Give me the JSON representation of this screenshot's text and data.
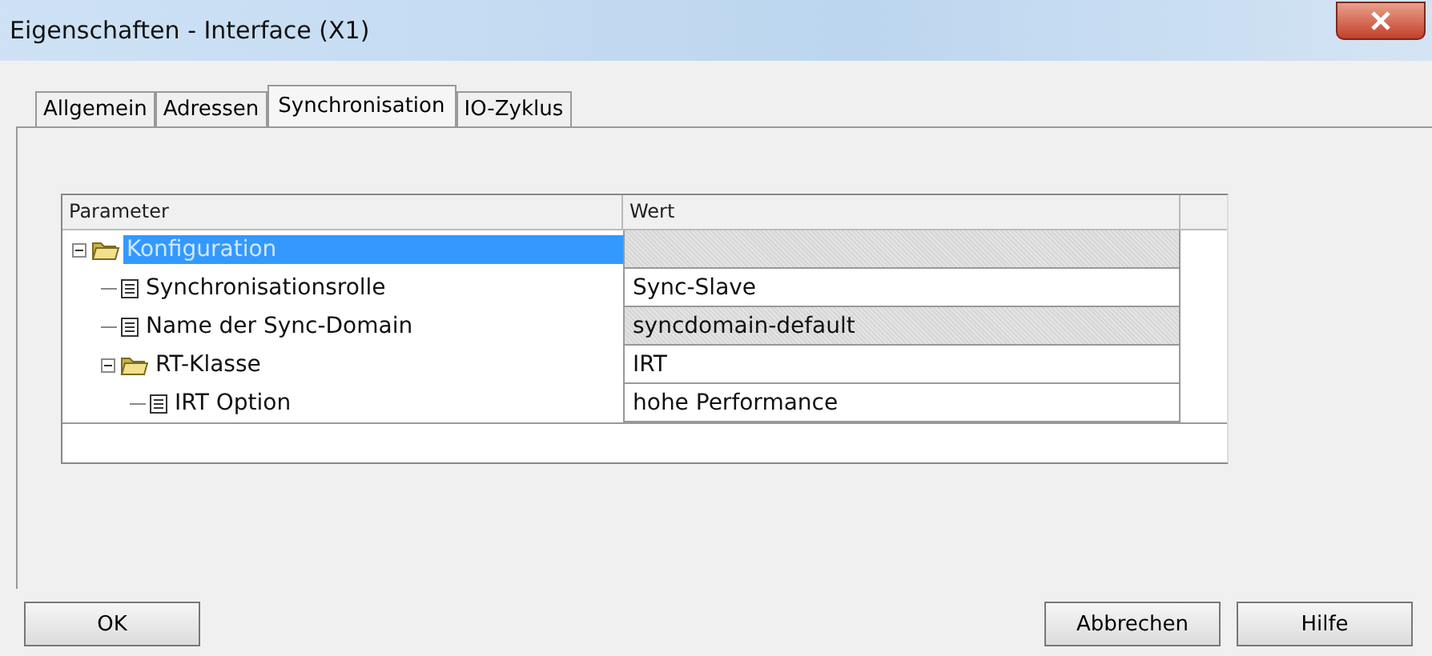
{
  "window": {
    "title": "Eigenschaften - Interface (X1)"
  },
  "tabs": [
    {
      "label": "Allgemein",
      "selected": false
    },
    {
      "label": "Adressen",
      "selected": false
    },
    {
      "label": "Synchronisation",
      "selected": true
    },
    {
      "label": "IO-Zyklus",
      "selected": false
    }
  ],
  "table": {
    "columns": [
      "Parameter",
      "Wert"
    ],
    "rows": [
      {
        "kind": "folder",
        "name": "Konfiguration",
        "expanded": true,
        "selected": true,
        "readonly": true,
        "children": [
          {
            "kind": "param",
            "name": "Synchronisationsrolle",
            "value": "Sync-Slave",
            "selected": false,
            "readonly": false
          },
          {
            "kind": "param",
            "name": "Name der Sync-Domain",
            "value": "syncdomain-default",
            "selected": false,
            "readonly": true
          },
          {
            "kind": "folder",
            "name": "RT-Klasse",
            "value": "IRT",
            "expanded": true,
            "selected": false,
            "readonly": false,
            "children": [
              {
                "kind": "param",
                "name": "IRT Option",
                "value": "hohe Performance",
                "selected": false,
                "readonly": false
              }
            ]
          }
        ]
      }
    ]
  },
  "buttons": [
    "OK",
    "Abbrechen",
    "Hilfe"
  ]
}
